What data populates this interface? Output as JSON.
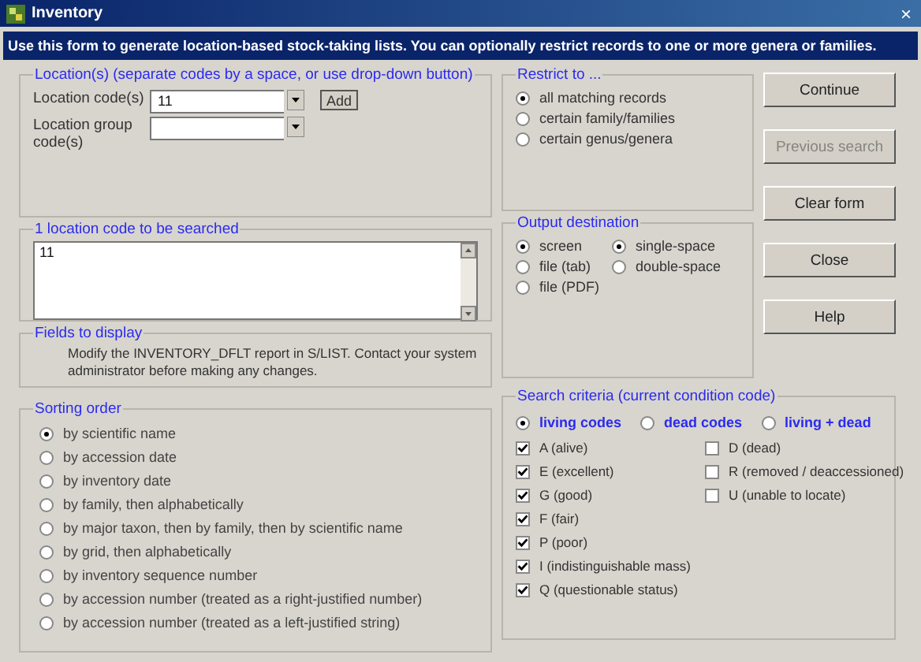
{
  "window": {
    "title": "Inventory",
    "close": "×"
  },
  "info": "Use this form to generate location-based stock-taking lists.  You can optionally restrict records to one or more genera or families.",
  "locations": {
    "title": "Location(s)  (separate codes by a space, or use drop-down button)",
    "fields": [
      {
        "label": "Location code(s)",
        "value": "11"
      },
      {
        "label": "Location group code(s)"
      }
    ],
    "add_button": "Add"
  },
  "searched": {
    "title": "1 location code to be searched",
    "lines": [
      "11"
    ]
  },
  "fields_to_display": {
    "title": "Fields to display",
    "text": "Modify the INVENTORY_DFLT report in S/LIST.  Contact your system administrator before making any changes."
  },
  "sorting": {
    "title": "Sorting order",
    "options": [
      {
        "label": "by scientific name",
        "selected": true
      },
      {
        "label": "by accession date",
        "selected": false
      },
      {
        "label": "by inventory date",
        "selected": false
      },
      {
        "label": "by family, then alphabetically",
        "selected": false
      },
      {
        "label": "by major taxon, then by family, then by scientific name",
        "selected": false
      },
      {
        "label": "by grid, then alphabetically",
        "selected": false
      },
      {
        "label": "by inventory sequence number",
        "selected": false
      },
      {
        "label": "by accession number (treated as a right-justified number)",
        "selected": false
      },
      {
        "label": "by accession number (treated as a left-justified string)",
        "selected": false
      }
    ]
  },
  "restrict": {
    "title": "Restrict to ...",
    "options": [
      {
        "label": "all matching records",
        "selected": true
      },
      {
        "label": "certain family/families",
        "selected": false
      },
      {
        "label": "certain genus/genera",
        "selected": false
      }
    ]
  },
  "output": {
    "title": "Output destination",
    "destination": [
      {
        "label": "screen",
        "selected": true
      },
      {
        "label": "file (tab)",
        "selected": false
      },
      {
        "label": "file (PDF)",
        "selected": false
      }
    ],
    "spacing": [
      {
        "label": "single-space",
        "selected": true
      },
      {
        "label": "double-space",
        "selected": false
      }
    ]
  },
  "criteria": {
    "title": "Search criteria (current condition code)",
    "modes": [
      {
        "label": "living codes",
        "selected": true
      },
      {
        "label": "dead codes",
        "selected": false
      },
      {
        "label": "living + dead",
        "selected": false
      }
    ],
    "living_codes": [
      {
        "label": "A (alive)",
        "checked": true
      },
      {
        "label": "E (excellent)",
        "checked": true
      },
      {
        "label": "G (good)",
        "checked": true
      },
      {
        "label": "F (fair)",
        "checked": true
      },
      {
        "label": "P (poor)",
        "checked": true
      },
      {
        "label": "I (indistinguishable mass)",
        "checked": true
      },
      {
        "label": "Q (questionable status)",
        "checked": true
      }
    ],
    "dead_codes": [
      {
        "label": "D (dead)",
        "checked": false
      },
      {
        "label": "R (removed / deaccessioned)",
        "checked": false
      },
      {
        "label": "U (unable to locate)",
        "checked": false
      }
    ]
  },
  "buttons": [
    {
      "label": "Continue",
      "disabled": false
    },
    {
      "label": "Previous search",
      "disabled": true
    },
    {
      "label": "Clear form",
      "disabled": false
    },
    {
      "label": "Close",
      "disabled": false
    },
    {
      "label": "Help",
      "disabled": false
    }
  ]
}
